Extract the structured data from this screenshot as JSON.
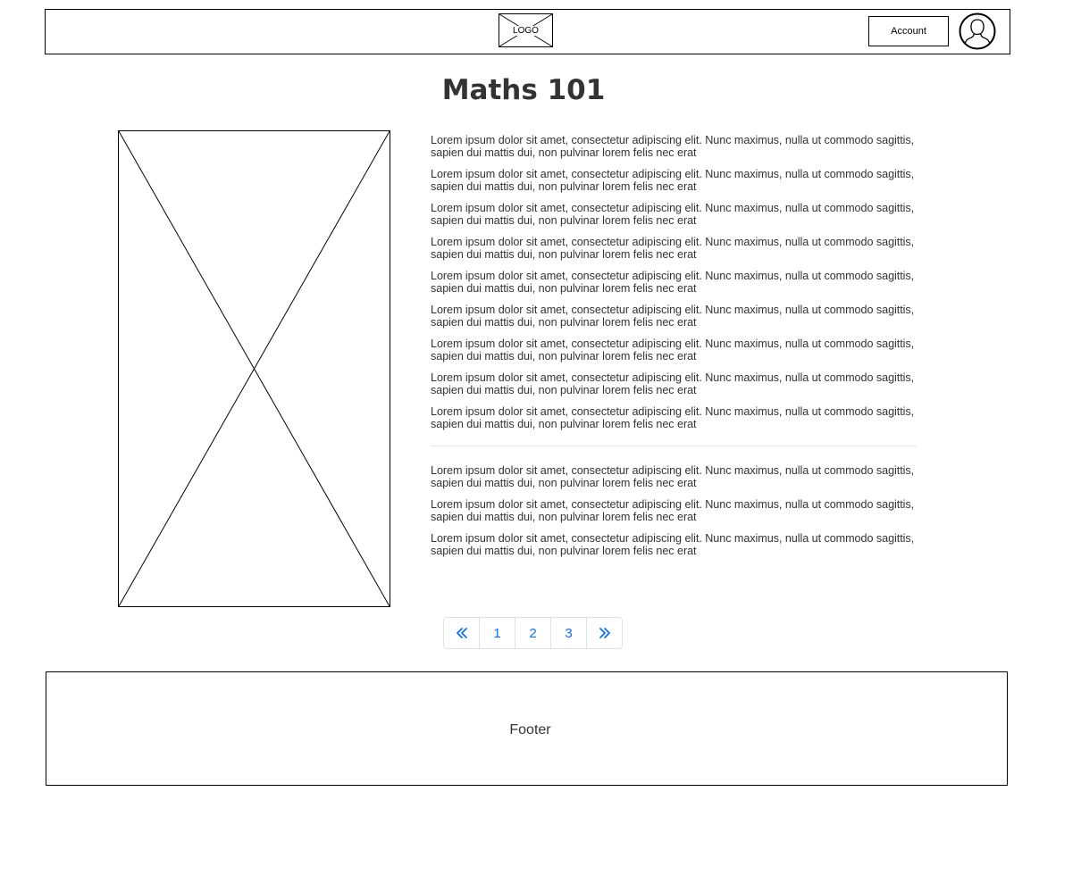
{
  "header": {
    "logo_text": "LOGO",
    "account_label": "Account",
    "avatar_icon": "user-avatar-icon"
  },
  "page": {
    "title": "Maths 101"
  },
  "image_placeholder": {
    "icon": "image-placeholder-icon"
  },
  "content": {
    "paragraphs_top": [
      "Lorem ipsum dolor sit amet, consectetur adipiscing elit. Nunc maximus, nulla ut commodo sagittis, sapien dui mattis dui, non pulvinar lorem felis nec erat",
      "Lorem ipsum dolor sit amet, consectetur adipiscing elit. Nunc maximus, nulla ut commodo sagittis, sapien dui mattis dui, non pulvinar lorem felis nec erat",
      "Lorem ipsum dolor sit amet, consectetur adipiscing elit. Nunc maximus, nulla ut commodo sagittis, sapien dui mattis dui, non pulvinar lorem felis nec erat",
      "Lorem ipsum dolor sit amet, consectetur adipiscing elit. Nunc maximus, nulla ut commodo sagittis, sapien dui mattis dui, non pulvinar lorem felis nec erat",
      "Lorem ipsum dolor sit amet, consectetur adipiscing elit. Nunc maximus, nulla ut commodo sagittis, sapien dui mattis dui, non pulvinar lorem felis nec erat",
      "Lorem ipsum dolor sit amet, consectetur adipiscing elit. Nunc maximus, nulla ut commodo sagittis, sapien dui mattis dui, non pulvinar lorem felis nec erat",
      "Lorem ipsum dolor sit amet, consectetur adipiscing elit. Nunc maximus, nulla ut commodo sagittis, sapien dui mattis dui, non pulvinar lorem felis nec erat",
      "Lorem ipsum dolor sit amet, consectetur adipiscing elit. Nunc maximus, nulla ut commodo sagittis, sapien dui mattis dui, non pulvinar lorem felis nec erat",
      "Lorem ipsum dolor sit amet, consectetur adipiscing elit. Nunc maximus, nulla ut commodo sagittis, sapien dui mattis dui, non pulvinar lorem felis nec erat"
    ],
    "paragraphs_bottom": [
      "Lorem ipsum dolor sit amet, consectetur adipiscing elit. Nunc maximus, nulla ut commodo sagittis, sapien dui mattis dui, non pulvinar lorem felis nec erat",
      "Lorem ipsum dolor sit amet, consectetur adipiscing elit. Nunc maximus, nulla ut commodo sagittis, sapien dui mattis dui, non pulvinar lorem felis nec erat",
      "Lorem ipsum dolor sit amet, consectetur adipiscing elit. Nunc maximus, nulla ut commodo sagittis, sapien dui mattis dui, non pulvinar lorem felis nec erat"
    ]
  },
  "pagination": {
    "prev_icon": "double-chevron-left-icon",
    "pages": [
      "1",
      "2",
      "3"
    ],
    "next_icon": "double-chevron-right-icon",
    "link_color": "#0d6efd"
  },
  "footer": {
    "label": "Footer"
  }
}
